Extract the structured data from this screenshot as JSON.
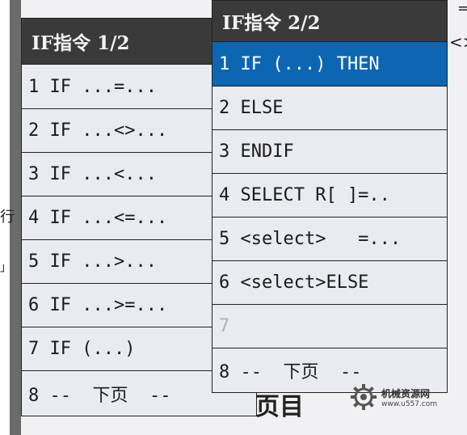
{
  "background": {
    "frag_top_right_1": "=",
    "frag_top_right_2": "<>",
    "frag_left_1": "行",
    "frag_left_2": "」",
    "frag_bottom": "页目"
  },
  "panel1": {
    "title": "IF指令   1/2",
    "items": [
      "1 IF ...=...",
      "2 IF ...<>...",
      "3 IF ...<...",
      "4 IF ...<=...",
      "5 IF ...>...",
      "6 IF ...>=...",
      "7 IF (...)",
      "8 --  下页  --"
    ]
  },
  "panel2": {
    "title": "IF指令   2/2",
    "items": [
      "1 IF (...) THEN",
      "2 ELSE",
      "3 ENDIF",
      "4 SELECT R[ ]=..",
      "5 <select>   =...",
      "6 <select>ELSE",
      "7",
      "8 --  下页  --"
    ],
    "selected_index": 0,
    "disabled_index": 6
  },
  "watermark": {
    "name": "机械资源网",
    "url": "www.u557.com"
  },
  "colors": {
    "selected": "#0d66b2",
    "title_bar": "#3a3a3a",
    "panel_bg": "#e9ebf1"
  }
}
